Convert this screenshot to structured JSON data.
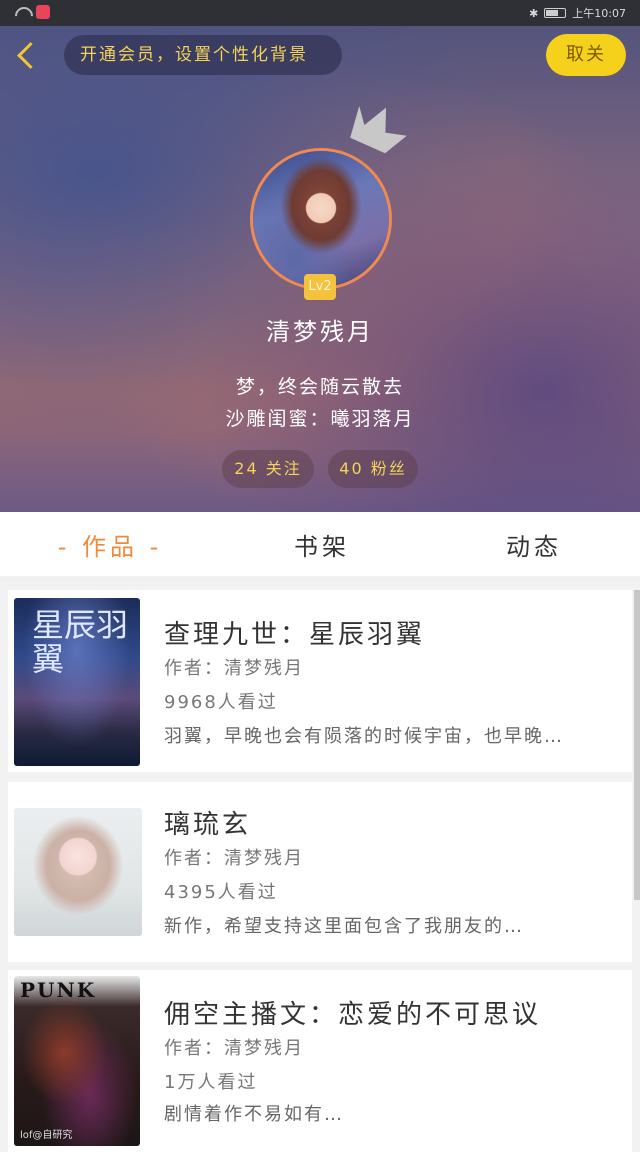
{
  "statusbar": {
    "time": "上午10:07"
  },
  "header": {
    "vip_prompt": "开通会员，设置个性化背景",
    "unfollow_label": "取关",
    "level": "Lv2",
    "nickname": "清梦残月",
    "signature_line1": "梦，终会随云散去",
    "signature_line2": "沙雕闺蜜：曦羽落月",
    "follow_count_label": "24 关注",
    "fans_count_label": "40 粉丝"
  },
  "tabs": [
    {
      "label": "- 作品 -",
      "active": true
    },
    {
      "label": "书架",
      "active": false
    },
    {
      "label": "动态",
      "active": false
    }
  ],
  "accent_color": "#ee8a3c",
  "books": [
    {
      "title": "查理九世：星辰羽翼",
      "author": "作者：清梦残月",
      "views": "9968人看过",
      "desc": "羽翼，早晚也会有陨落的时候宇宙，也早晚…",
      "cover_text": "星辰羽翼"
    },
    {
      "title": "璃琉玄",
      "author": "作者：清梦残月",
      "views": "4395人看过",
      "desc": "新作，希望支持这里面包含了我朋友的…"
    },
    {
      "title": "佣空主播文：恋爱的不可思议",
      "author": "作者：清梦残月",
      "views": "1万人看过",
      "desc": "剧情着作不易如有…",
      "cover_text": "PUNK",
      "cover_sub": "lof@自研究"
    }
  ]
}
